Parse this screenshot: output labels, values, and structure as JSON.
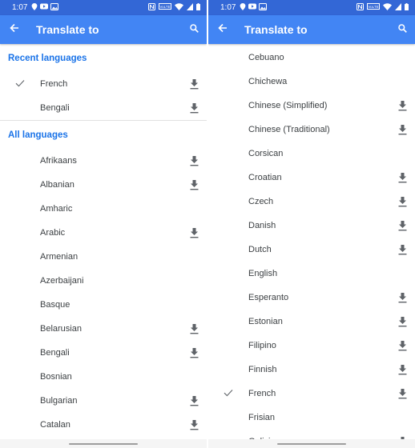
{
  "status_bar": {
    "time": "1:07",
    "left_icons": [
      "location-pin-icon",
      "youtube-icon",
      "gallery-icon"
    ],
    "right_icons": [
      "nfc-icon",
      "volte-icon",
      "wifi-icon",
      "signal-icon",
      "battery-icon"
    ],
    "volte_label": "VoLTE"
  },
  "app_bar": {
    "title": "Translate to",
    "back_icon": "arrow-back-icon",
    "search_icon": "search-icon"
  },
  "colors": {
    "status_bar": "#3367d6",
    "app_bar": "#4285f4",
    "section_header": "#1a73e8",
    "text": "#3c4043",
    "icon": "#5f6368"
  },
  "left_screen": {
    "sections": [
      {
        "header": "Recent languages",
        "items": [
          {
            "label": "French",
            "selected": true,
            "downloadable": true
          },
          {
            "label": "Bengali",
            "selected": false,
            "downloadable": true
          }
        ]
      },
      {
        "header": "All languages",
        "items": [
          {
            "label": "Afrikaans",
            "selected": false,
            "downloadable": true
          },
          {
            "label": "Albanian",
            "selected": false,
            "downloadable": true
          },
          {
            "label": "Amharic",
            "selected": false,
            "downloadable": false
          },
          {
            "label": "Arabic",
            "selected": false,
            "downloadable": true
          },
          {
            "label": "Armenian",
            "selected": false,
            "downloadable": false
          },
          {
            "label": "Azerbaijani",
            "selected": false,
            "downloadable": false
          },
          {
            "label": "Basque",
            "selected": false,
            "downloadable": false
          },
          {
            "label": "Belarusian",
            "selected": false,
            "downloadable": true
          },
          {
            "label": "Bengali",
            "selected": false,
            "downloadable": true
          },
          {
            "label": "Bosnian",
            "selected": false,
            "downloadable": false
          },
          {
            "label": "Bulgarian",
            "selected": false,
            "downloadable": true
          },
          {
            "label": "Catalan",
            "selected": false,
            "downloadable": true
          }
        ]
      }
    ]
  },
  "right_screen": {
    "items": [
      {
        "label": "Cebuano",
        "selected": false,
        "downloadable": false
      },
      {
        "label": "Chichewa",
        "selected": false,
        "downloadable": false
      },
      {
        "label": "Chinese (Simplified)",
        "selected": false,
        "downloadable": true
      },
      {
        "label": "Chinese (Traditional)",
        "selected": false,
        "downloadable": true
      },
      {
        "label": "Corsican",
        "selected": false,
        "downloadable": false
      },
      {
        "label": "Croatian",
        "selected": false,
        "downloadable": true
      },
      {
        "label": "Czech",
        "selected": false,
        "downloadable": true
      },
      {
        "label": "Danish",
        "selected": false,
        "downloadable": true
      },
      {
        "label": "Dutch",
        "selected": false,
        "downloadable": true
      },
      {
        "label": "English",
        "selected": false,
        "downloadable": false
      },
      {
        "label": "Esperanto",
        "selected": false,
        "downloadable": true
      },
      {
        "label": "Estonian",
        "selected": false,
        "downloadable": true
      },
      {
        "label": "Filipino",
        "selected": false,
        "downloadable": true
      },
      {
        "label": "Finnish",
        "selected": false,
        "downloadable": true
      },
      {
        "label": "French",
        "selected": true,
        "downloadable": true
      },
      {
        "label": "Frisian",
        "selected": false,
        "downloadable": false
      },
      {
        "label": "Galician",
        "selected": false,
        "downloadable": true
      }
    ]
  }
}
